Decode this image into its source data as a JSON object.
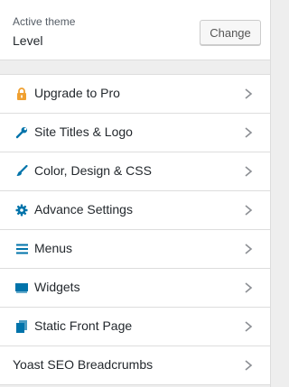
{
  "theme": {
    "caption": "Active theme",
    "name": "Level",
    "change_label": "Change"
  },
  "menu": {
    "items": [
      {
        "label": "Upgrade to Pro",
        "icon": "lock-icon"
      },
      {
        "label": "Site Titles & Logo",
        "icon": "wrench-icon"
      },
      {
        "label": "Color, Design & CSS",
        "icon": "paintbrush-icon"
      },
      {
        "label": "Advance Settings",
        "icon": "gear-icon"
      },
      {
        "label": "Menus",
        "icon": "menu-lines-icon"
      },
      {
        "label": "Widgets",
        "icon": "widgets-icon"
      },
      {
        "label": "Static Front Page",
        "icon": "pages-icon"
      },
      {
        "label": "Yoast SEO Breadcrumbs",
        "icon": ""
      }
    ]
  },
  "colors": {
    "accent": "#0073aa",
    "upgrade_icon": "#f0a030"
  }
}
